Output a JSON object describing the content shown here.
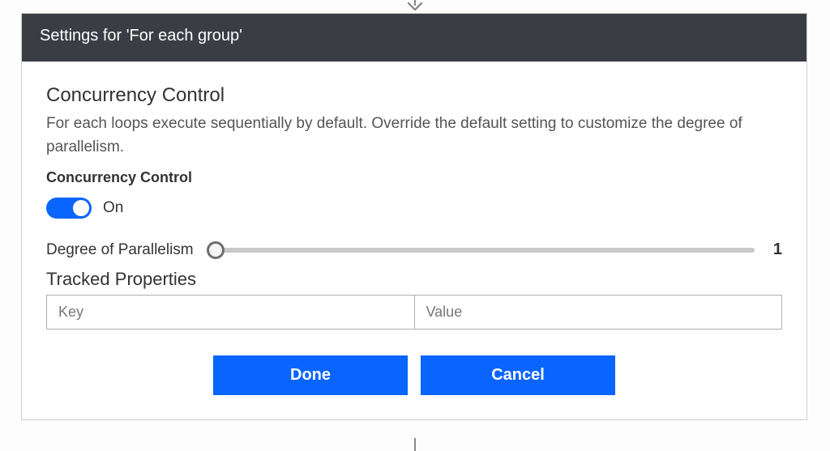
{
  "header": {
    "title": "Settings for 'For each group'"
  },
  "concurrency": {
    "section_title": "Concurrency Control",
    "description": "For each loops execute sequentially by default. Override the default setting to customize the degree of parallelism.",
    "toggle_label": "Concurrency Control",
    "toggle_state": "On",
    "slider_label": "Degree of Parallelism",
    "slider_value": "1"
  },
  "tracked": {
    "title": "Tracked Properties",
    "key_placeholder": "Key",
    "value_placeholder": "Value"
  },
  "buttons": {
    "done": "Done",
    "cancel": "Cancel"
  }
}
